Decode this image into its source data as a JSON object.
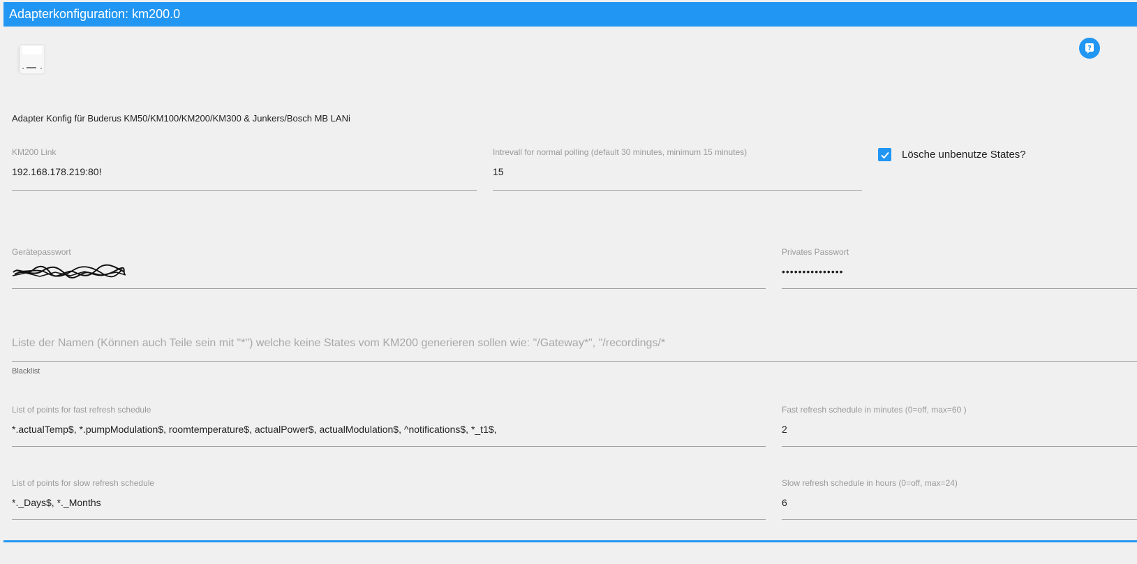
{
  "window": {
    "title": "Adapterkonfiguration: km200.0"
  },
  "description": "Adapter Konfig für Buderus KM50/KM100/KM200/KM300 & Junkers/Bosch MB LANi",
  "fields": {
    "km200_link": {
      "label": "KM200 Link",
      "value": "192.168.178.219:80!"
    },
    "interval": {
      "label": "Intrevall for normal polling (default 30 minutes, minimum 15 minutes)",
      "value": "15"
    },
    "delete_states": {
      "label": "Lösche unbenutze States?",
      "checked": true
    },
    "device_password": {
      "label": "Gerätepasswort",
      "value": "scribbled-out"
    },
    "private_password": {
      "label": "Privates Passwort",
      "value": "•••••••••••••••"
    },
    "blacklist": {
      "placeholder": "Liste der Namen (Können auch Teile sein mit \"*\") welche keine States vom KM200 generieren sollen wie: \"/Gateway*\", \"/recordings/*",
      "helper": "Blacklist"
    },
    "fast_points": {
      "label": "List of points for fast refresh schedule",
      "value": "*.actualTemp$, *.pumpModulation$, roomtemperature$, actualPower$, actualModulation$, ^notifications$, *_t1$,"
    },
    "fast_schedule": {
      "label": "Fast refresh schedule in minutes (0=off, max=60 )",
      "value": "2"
    },
    "slow_points": {
      "label": "List of points for slow refresh schedule",
      "value": "*._Days$, *._Months"
    },
    "slow_schedule": {
      "label": "Slow refresh schedule in hours (0=off, max=24)",
      "value": "6"
    }
  },
  "icons": {
    "help": "help-icon",
    "logo": "km200-device-logo",
    "check": "checkmark-icon"
  },
  "colors": {
    "accent": "#2196f3",
    "background": "#f0f0f0"
  }
}
